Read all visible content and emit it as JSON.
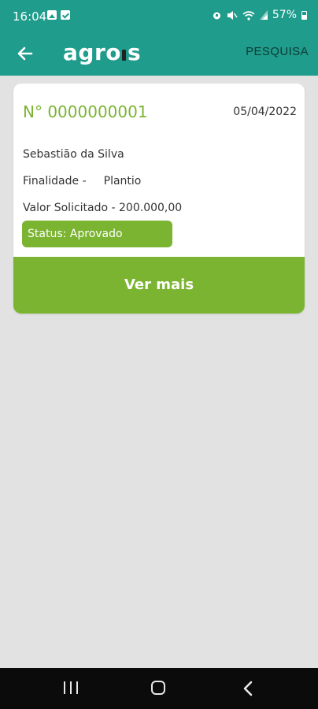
{
  "status_bar": {
    "time": "16:04",
    "battery": "57%",
    "icons_left": [
      "photo-icon",
      "check-icon"
    ],
    "icons_right": [
      "alarm-icon",
      "mute-icon",
      "wifi-icon",
      "signal-icon",
      "battery-icon"
    ]
  },
  "app_bar": {
    "back_icon": "arrow-left-icon",
    "brand_pre": "agro",
    "brand_post": "s",
    "search_label": "PESQUISA"
  },
  "card": {
    "number": "N° 0000000001",
    "date": "05/04/2022",
    "name": "Sebastião da Silva",
    "purpose_label": "Finalidade -",
    "purpose_value": "Plantio",
    "value_text": "Valor Solicitado - 200.000,00",
    "status": "Status: Aprovado",
    "more_button": "Ver mais"
  },
  "nav_bar": {
    "items": [
      "recents-icon",
      "home-icon",
      "back-icon"
    ]
  },
  "colors": {
    "primary": "#1f9c8c",
    "accent": "#7bb431",
    "background": "#e2e2e2"
  }
}
